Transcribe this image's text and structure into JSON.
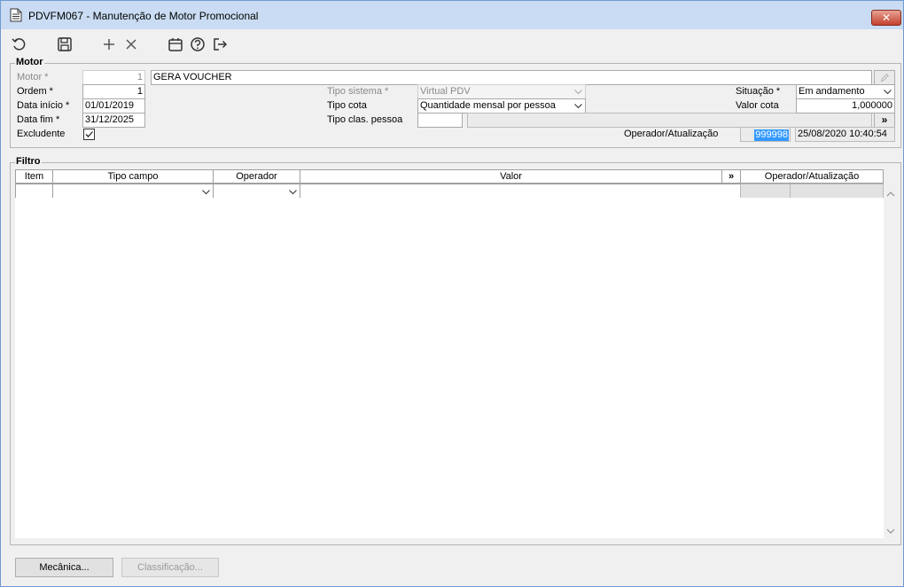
{
  "window": {
    "title": "PDVFM067 - Manutenção de Motor Promocional",
    "close_label": "✕"
  },
  "toolbar": {
    "icons": [
      "undo-icon",
      "save-icon",
      "add-icon",
      "delete-icon",
      "calendar-icon",
      "help-icon",
      "exit-icon"
    ]
  },
  "motor": {
    "group_title": "Motor",
    "motor_label": "Motor *",
    "motor_code": "1",
    "motor_name": "GERA VOUCHER",
    "ordem_label": "Ordem *",
    "ordem_value": "1",
    "data_inicio_label": "Data início *",
    "data_inicio_value": "01/01/2019",
    "data_fim_label": "Data fim *",
    "data_fim_value": "31/12/2025",
    "excludente_label": "Excludente",
    "excludente_checked": true,
    "tipo_sistema_label": "Tipo sistema *",
    "tipo_sistema_value": "Virtual PDV",
    "tipo_cota_label": "Tipo cota",
    "tipo_cota_value": "Quantidade mensal por pessoa",
    "tipo_clas_label": "Tipo clas. pessoa",
    "tipo_clas_code": "",
    "tipo_clas_desc": "",
    "more_label": "»",
    "situacao_label": "Situação *",
    "situacao_value": "Em andamento",
    "valor_cota_label": "Valor cota",
    "valor_cota_value": "1,000000",
    "operador_label": "Operador/Atualização",
    "operador_value": "999998",
    "atualizacao_value": "25/08/2020 10:40:54"
  },
  "filtro": {
    "group_title": "Filtro",
    "columns": {
      "item": "Item",
      "tipo_campo": "Tipo campo",
      "operador": "Operador",
      "valor": "Valor",
      "more": "»",
      "operador_atualizacao": "Operador/Atualização"
    }
  },
  "buttons": {
    "mecanica": "Mecânica...",
    "classificacao": "Classificação..."
  },
  "colors": {
    "titlebar": "#c9dcf3",
    "selection": "#3399ff",
    "close": "#c5412e"
  }
}
